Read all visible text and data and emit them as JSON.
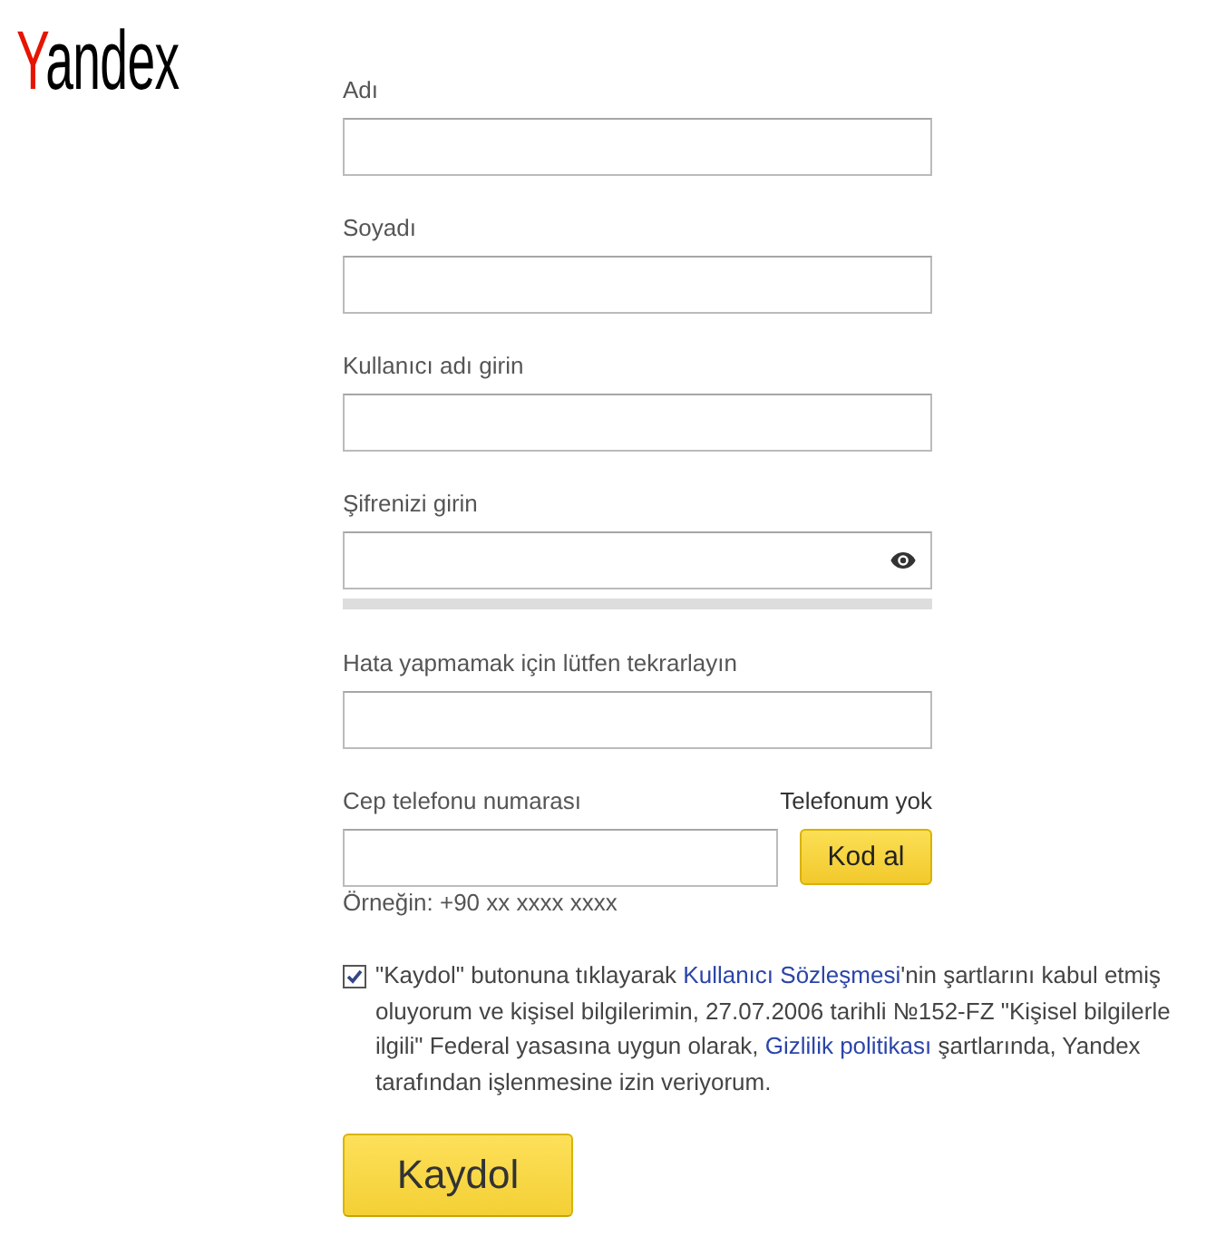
{
  "logo": "Yandex",
  "fields": [
    {
      "kind": "text",
      "label": "Adı"
    },
    {
      "kind": "text",
      "label": "Soyadı"
    },
    {
      "kind": "text",
      "label": "Kullanıcı adı girin"
    },
    {
      "kind": "password",
      "label": "Şifrenizi girin",
      "strength": {
        "level": 0
      }
    },
    {
      "kind": "text",
      "label": "Hata yapmamak için lütfen tekrarlayın"
    }
  ],
  "phone": {
    "label": "Cep telefonu numarası",
    "link": "Telefonum yok",
    "button": "Kod al",
    "hint": "Örneğin: +90 xx xxxx xxxx"
  },
  "agreement": {
    "checked": true,
    "parts": [
      {
        "kind": "text",
        "text": "\"Kaydol\" butonuna tıklayarak "
      },
      {
        "kind": "link",
        "text": "Kullanıcı Sözleşmesi"
      },
      {
        "kind": "text",
        "text": "'nin şartlarını kabul etmiş oluyorum ve kişisel bilgilerimin, 27.07.2006 tarihli №152-FZ \"Kişisel bilgilerle ilgili\" Federal yasasına uygun olarak, "
      },
      {
        "kind": "link",
        "text": "Gizlilik politikası"
      },
      {
        "kind": "text",
        "text": " şartlarında, Yandex tarafından işlenmesine izin veriyorum."
      }
    ]
  },
  "submit": "Kaydol"
}
